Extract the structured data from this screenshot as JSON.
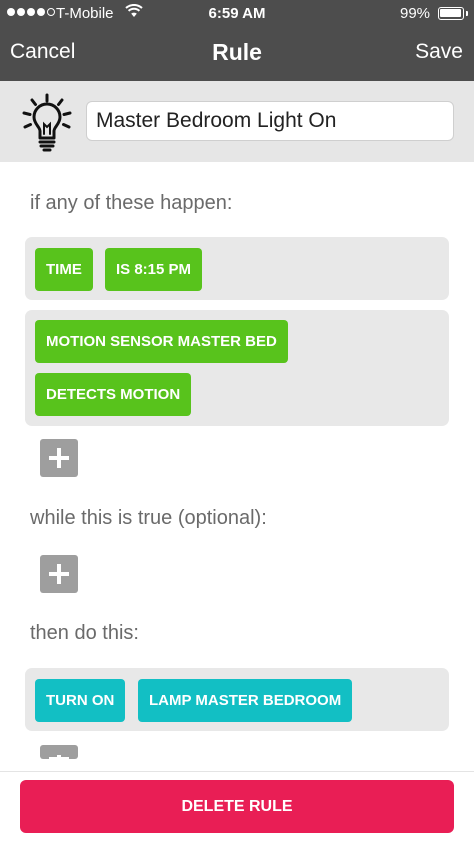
{
  "status_bar": {
    "carrier": "T-Mobile",
    "time": "6:59 AM",
    "battery_percent": "99%",
    "battery_level": 0.99,
    "signal_bars": 4,
    "signal_icon": "signal-dots-icon",
    "wifi_icon": "wifi-icon",
    "battery_icon": "battery-icon"
  },
  "nav": {
    "cancel_label": "Cancel",
    "title": "Rule",
    "save_label": "Save"
  },
  "rule": {
    "icon": "lightbulb-icon",
    "name": "Master Bedroom Light On"
  },
  "triggers": {
    "label": "if any of these happen:",
    "groups": [
      {
        "chips": [
          "TIME",
          "IS 8:15 PM"
        ]
      },
      {
        "chips": [
          "MOTION SENSOR MASTER BED",
          "DETECTS MOTION"
        ]
      }
    ]
  },
  "conditions": {
    "label": "while this is true (optional):"
  },
  "actions": {
    "label": "then do this:",
    "groups": [
      {
        "chips": [
          "TURN ON",
          "LAMP MASTER BEDROOM"
        ]
      }
    ]
  },
  "add_icon": "plus-icon",
  "delete_label": "DELETE RULE",
  "colors": {
    "header": "#4d4d4d",
    "trigger_chip": "#58c31c",
    "action_chip": "#12bfc4",
    "delete": "#e91e55",
    "add_button": "#9e9e9e"
  }
}
